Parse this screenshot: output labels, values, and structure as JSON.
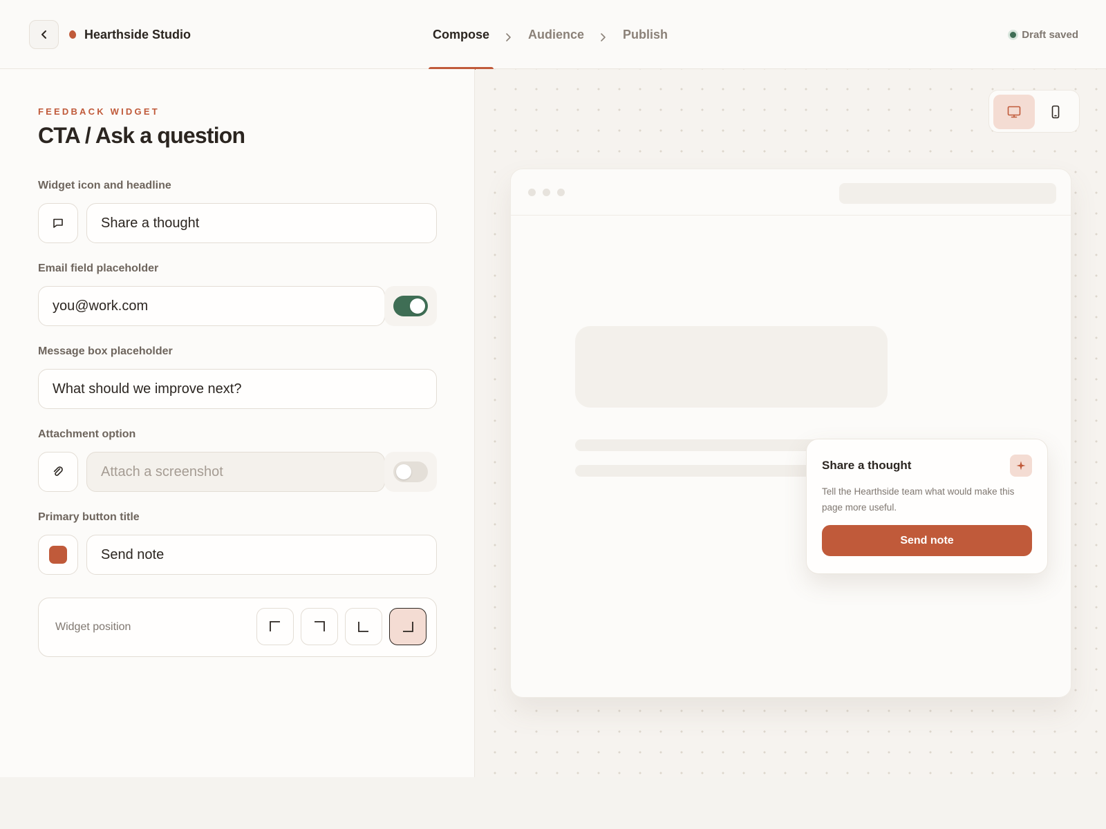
{
  "header": {
    "brand": "Hearthside Studio",
    "steps": [
      {
        "label": "Compose",
        "active": true
      },
      {
        "label": "Audience",
        "active": false
      },
      {
        "label": "Publish",
        "active": false
      }
    ],
    "status": "Draft saved"
  },
  "form": {
    "eyebrow": "FEEDBACK WIDGET",
    "title": "CTA / Ask a question",
    "headline": {
      "label": "Widget icon and headline",
      "value": "Share a thought",
      "icon": "chat-bubble-icon"
    },
    "email": {
      "label": "Email field placeholder",
      "value": "you@work.com",
      "enabled": true
    },
    "message": {
      "label": "Message box placeholder",
      "value": "What should we improve next?"
    },
    "attachment": {
      "label": "Attachment option",
      "placeholder": "Attach a screenshot",
      "enabled": false,
      "icon": "paperclip-icon"
    },
    "primary_button": {
      "label": "Primary button title",
      "value": "Send note",
      "color": "#c05a3a"
    },
    "position": {
      "label": "Widget position",
      "options": [
        "top-left",
        "top-right",
        "bottom-left",
        "bottom-right"
      ],
      "selected": "bottom-right"
    }
  },
  "preview": {
    "device_modes": [
      "desktop",
      "mobile"
    ],
    "active_device": "desktop",
    "widget": {
      "title": "Share a thought",
      "body": "Tell the Hearthside team what would make this page more useful.",
      "cta": "Send note"
    }
  },
  "colors": {
    "accent": "#c05a3a",
    "success": "#3f6e55",
    "accent_soft": "#f4dcd3"
  }
}
